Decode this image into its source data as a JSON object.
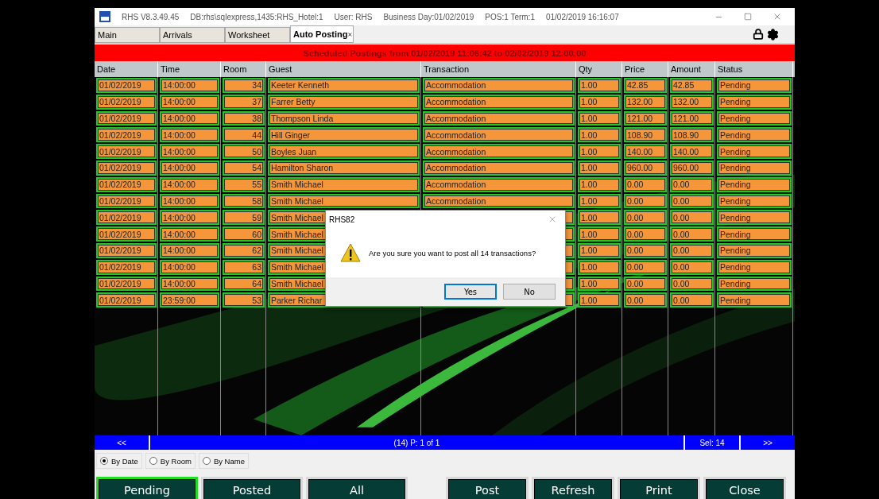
{
  "window": {
    "title": "RHS V8.3.49.45",
    "database": "DB:rhs\\sqlexpress,1435:RHS_Hotel:1",
    "user": "User: RHS",
    "business_day": "Business Day:01/02/2019",
    "pos": "POS:1 Term:1",
    "clock": "01/02/2019 16:16:07"
  },
  "tabs": [
    {
      "label": "Main",
      "selected": false,
      "closable": false
    },
    {
      "label": "Arrivals",
      "selected": false,
      "closable": false
    },
    {
      "label": "Worksheet",
      "selected": false,
      "closable": false
    },
    {
      "label": "Auto Posting",
      "selected": true,
      "closable": true
    }
  ],
  "banner": "Scheduled Postings from 01/02/2019 11:06:42 to 02/02/2019 12:00:00",
  "table": {
    "columns": [
      "Date",
      "Time",
      "Room",
      "Guest",
      "Transaction",
      "Qty",
      "Price",
      "Amount",
      "Status"
    ],
    "rows": [
      {
        "date": "01/02/2019",
        "time": "14:00:00",
        "room": "34",
        "guest": "Keeter Kenneth",
        "transaction": "Accommodation",
        "qty": "1.00",
        "price": "42.85",
        "amount": "42.85",
        "status": "Pending"
      },
      {
        "date": "01/02/2019",
        "time": "14:00:00",
        "room": "37",
        "guest": "Farrer Betty",
        "transaction": "Accommodation",
        "qty": "1.00",
        "price": "132.00",
        "amount": "132.00",
        "status": "Pending"
      },
      {
        "date": "01/02/2019",
        "time": "14:00:00",
        "room": "38",
        "guest": "Thompson Linda",
        "transaction": "Accommodation",
        "qty": "1.00",
        "price": "121.00",
        "amount": "121.00",
        "status": "Pending"
      },
      {
        "date": "01/02/2019",
        "time": "14:00:00",
        "room": "44",
        "guest": "Hill Ginger",
        "transaction": "Accommodation",
        "qty": "1.00",
        "price": "108.90",
        "amount": "108.90",
        "status": "Pending"
      },
      {
        "date": "01/02/2019",
        "time": "14:00:00",
        "room": "50",
        "guest": "Boyles Juan",
        "transaction": "Accommodation",
        "qty": "1.00",
        "price": "140.00",
        "amount": "140.00",
        "status": "Pending"
      },
      {
        "date": "01/02/2019",
        "time": "14:00:00",
        "room": "54",
        "guest": "Hamilton Sharon",
        "transaction": "Accommodation",
        "qty": "1.00",
        "price": "960.00",
        "amount": "960.00",
        "status": "Pending"
      },
      {
        "date": "01/02/2019",
        "time": "14:00:00",
        "room": "55",
        "guest": "Smith Michael",
        "transaction": "Accommodation",
        "qty": "1.00",
        "price": "0.00",
        "amount": "0.00",
        "status": "Pending"
      },
      {
        "date": "01/02/2019",
        "time": "14:00:00",
        "room": "58",
        "guest": "Smith Michael",
        "transaction": "Accommodation",
        "qty": "1.00",
        "price": "0.00",
        "amount": "0.00",
        "status": "Pending"
      },
      {
        "date": "01/02/2019",
        "time": "14:00:00",
        "room": "59",
        "guest": "Smith Michael",
        "qty": "1.00",
        "price": "0.00",
        "amount": "0.00",
        "status": "Pending"
      },
      {
        "date": "01/02/2019",
        "time": "14:00:00",
        "room": "60",
        "guest": "Smith Michael",
        "qty": "1.00",
        "price": "0.00",
        "amount": "0.00",
        "status": "Pending"
      },
      {
        "date": "01/02/2019",
        "time": "14:00:00",
        "room": "62",
        "guest": "Smith Michael",
        "qty": "1.00",
        "price": "0.00",
        "amount": "0.00",
        "status": "Pending"
      },
      {
        "date": "01/02/2019",
        "time": "14:00:00",
        "room": "63",
        "guest": "Smith Michael",
        "qty": "1.00",
        "price": "0.00",
        "amount": "0.00",
        "status": "Pending"
      },
      {
        "date": "01/02/2019",
        "time": "14:00:00",
        "room": "64",
        "guest": "Smith Michael",
        "qty": "1.00",
        "price": "0.00",
        "amount": "0.00",
        "status": "Pending"
      },
      {
        "date": "01/02/2019",
        "time": "23:59:00",
        "room": "53",
        "guest": "Parker Richar",
        "qty": "1.00",
        "price": "0.00",
        "amount": "0.00",
        "status": "Pending"
      }
    ]
  },
  "pager": {
    "previous": "<<",
    "summary": "(14) P: 1 of 1",
    "selection": "Sel: 14",
    "next": ">>"
  },
  "sort_options": [
    {
      "label": "By Date",
      "selected": true
    },
    {
      "label": "By Room",
      "selected": false
    },
    {
      "label": "By Name",
      "selected": false
    }
  ],
  "filter_buttons": [
    {
      "label": "Pending",
      "selected": true
    },
    {
      "label": "Posted",
      "selected": false
    },
    {
      "label": "All",
      "selected": false
    }
  ],
  "action_buttons": [
    "Post",
    "Refresh",
    "Print",
    "Close"
  ],
  "dialog": {
    "title": "RHS82",
    "message": "Are you sure you want to post all 14 transactions?",
    "buttons": [
      {
        "label": "Yes",
        "default": true
      },
      {
        "label": "No",
        "default": false
      }
    ]
  }
}
